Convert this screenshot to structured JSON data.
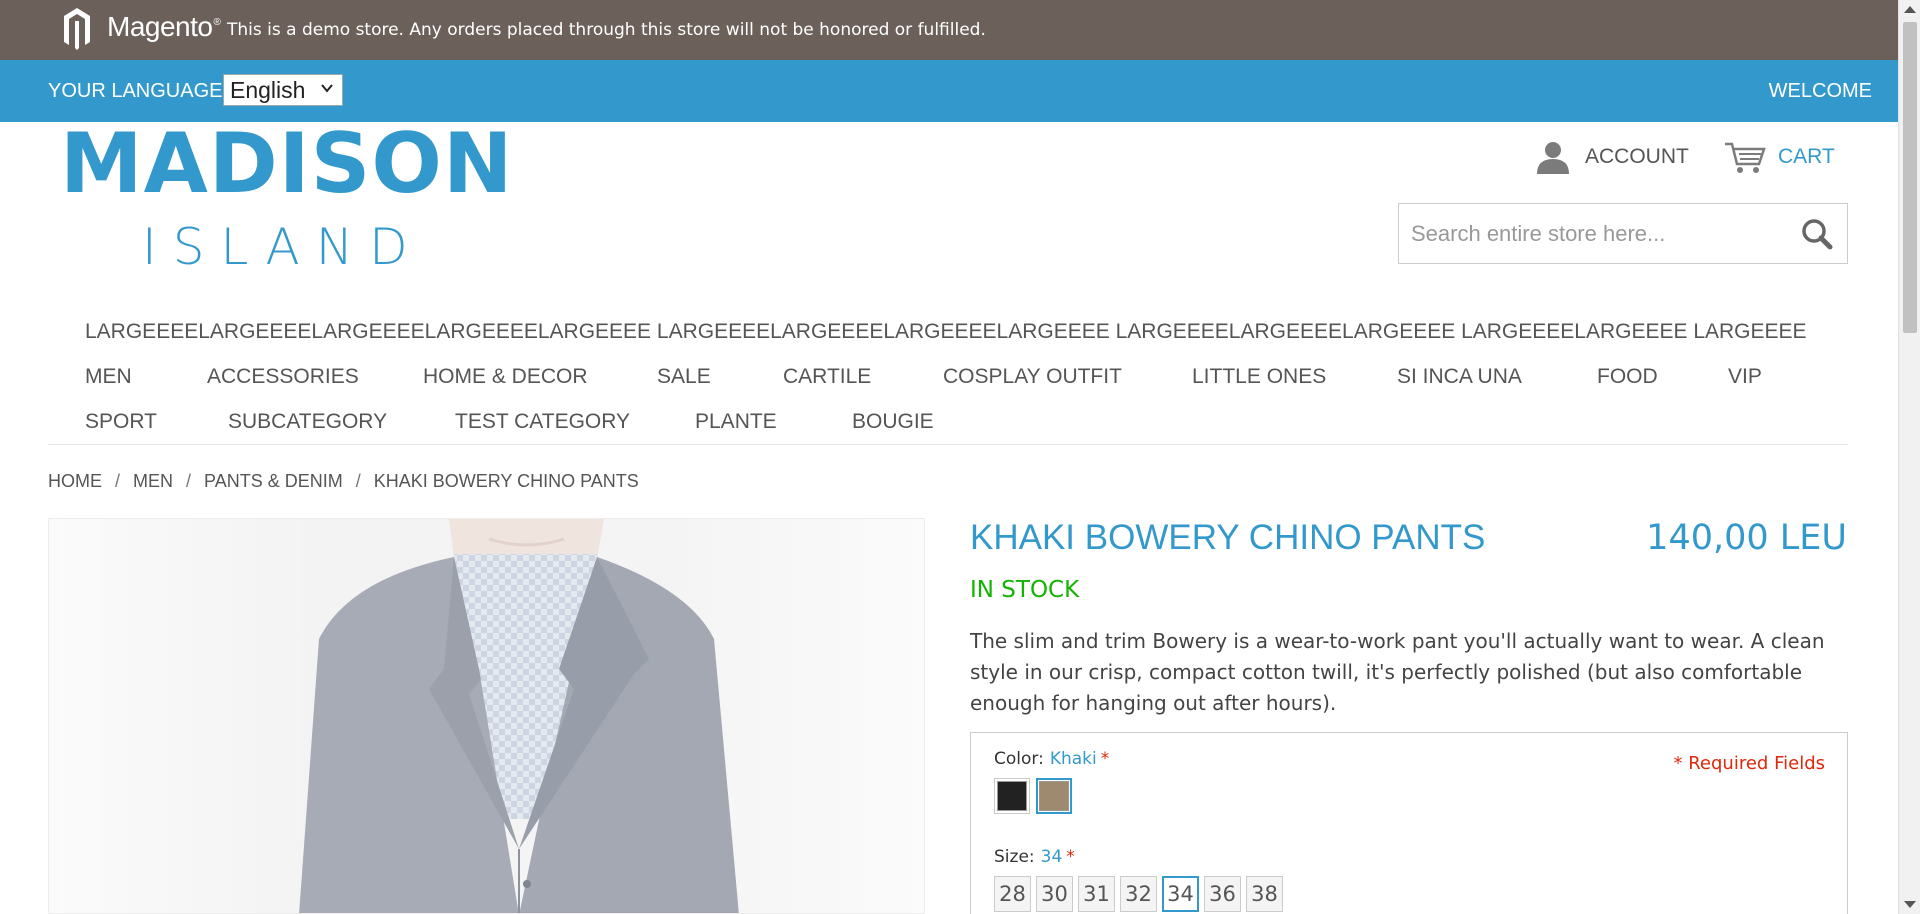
{
  "demo_notice": {
    "brand": "Magento",
    "brand_mark": "®",
    "text": "This is a demo store. Any orders placed through this store will not be honored or fulfilled."
  },
  "language_bar": {
    "label": "YOUR LANGUAGE:",
    "selected_language": "English",
    "welcome": "WELCOME"
  },
  "logo": {
    "line1": "MADISON",
    "line2": "ISLAND"
  },
  "header": {
    "account_label": "ACCOUNT",
    "cart_label": "CART",
    "search_placeholder": "Search entire store here..."
  },
  "nav": {
    "items": [
      "LARGEEEELARGEEEELARGEEEELARGEEEELARGEEEE LARGEEEELARGEEEELARGEEEELARGEEEE LARGEEEELARGEEEELARGEEEE LARGEEEELARGEEEE LARGEEEE",
      "MEN",
      "ACCESSORIES",
      "HOME & DECOR",
      "SALE",
      "CARTILE",
      "COSPLAY OUTFIT",
      "LITTLE ONES",
      "SI INCA UNA",
      "FOOD",
      "VIP",
      "SPORT",
      "SUBCATEGORY",
      "TEST CATEGORY",
      "PLANTE",
      "BOUGIE"
    ]
  },
  "breadcrumb": {
    "items": [
      "HOME",
      "MEN",
      "PANTS & DENIM"
    ],
    "separator": "/",
    "current": "KHAKI BOWERY CHINO PANTS"
  },
  "product": {
    "name": "KHAKI BOWERY CHINO PANTS",
    "price": "140,00 LEU",
    "availability": "IN STOCK",
    "description": "The slim and trim Bowery is a wear-to-work pant you'll actually want to wear. A clean style in our crisp, compact cotton twill, it's perfectly polished (but also comfortable enough for hanging out after hours).",
    "required_note": "* Required Fields",
    "color": {
      "label": "Color:",
      "selected": "Khaki",
      "required_mark": "*",
      "swatches": [
        {
          "name": "Charcoal",
          "hex": "#222222",
          "active": false
        },
        {
          "name": "Khaki",
          "hex": "#9e8a6e",
          "active": true
        }
      ]
    },
    "size": {
      "label": "Size:",
      "selected": "34",
      "required_mark": "*",
      "options": [
        "28",
        "30",
        "31",
        "32",
        "34",
        "36",
        "38"
      ],
      "active_option": "34"
    }
  },
  "colors": {
    "accent": "#3399cc",
    "demo_bar": "#6b615a",
    "in_stock": "#11b400",
    "required": "#df280a"
  }
}
